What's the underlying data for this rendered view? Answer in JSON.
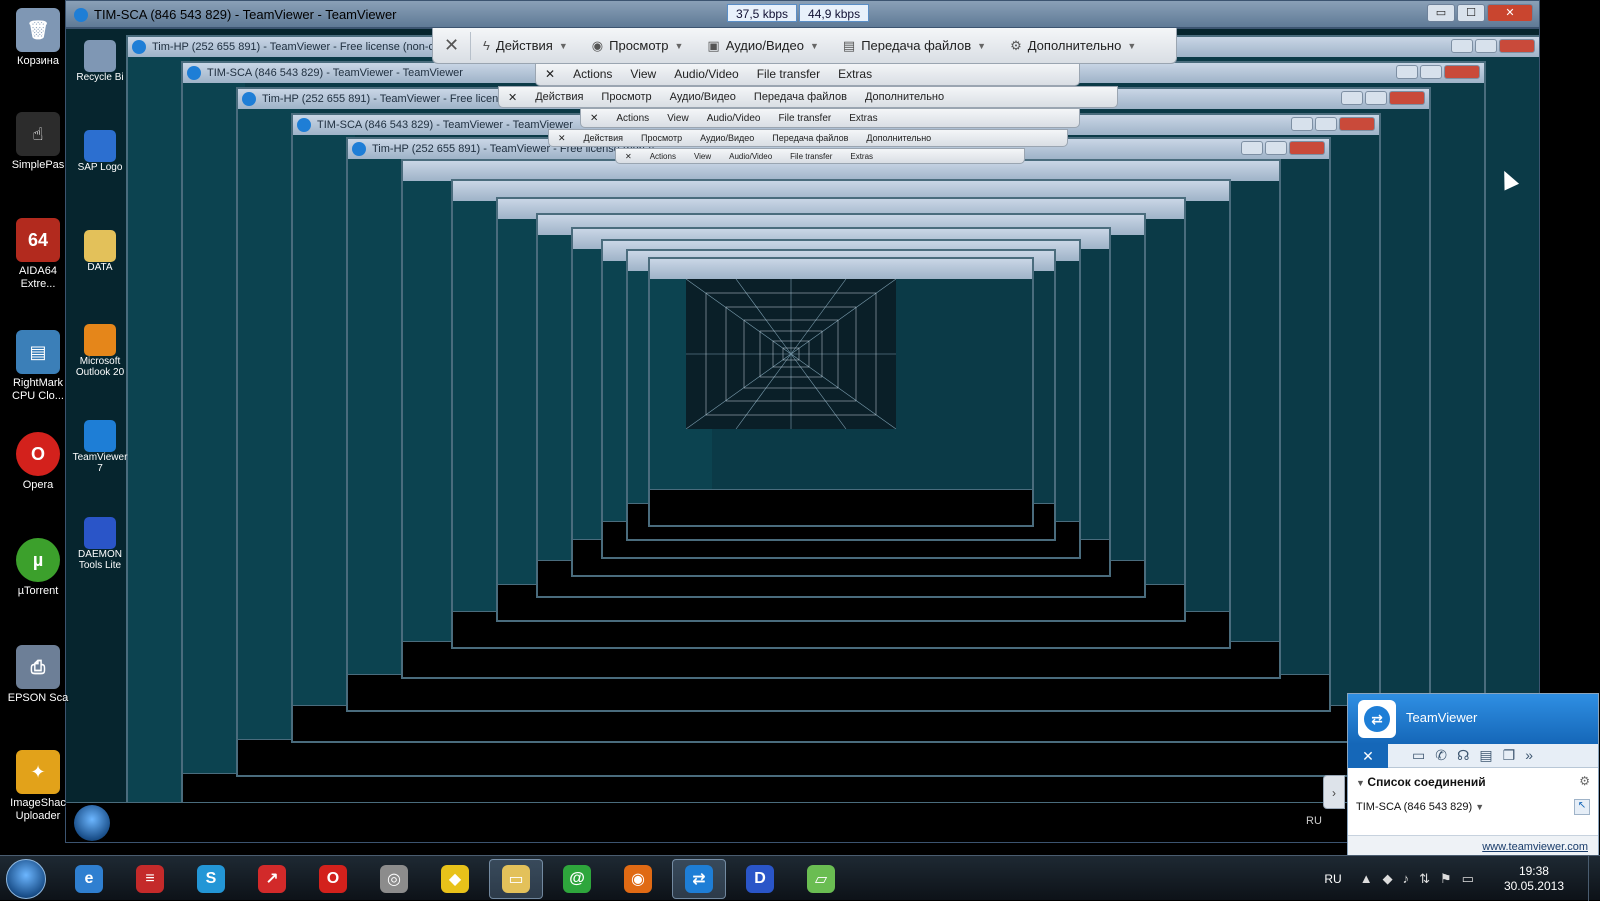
{
  "window": {
    "title": "TIM-SCA (846 543 829) - TeamViewer - TeamViewer",
    "caption_minimize": "▭",
    "caption_maximize": "☐",
    "caption_close": "✕"
  },
  "speed_indicator": {
    "upload": "37,5 kbps",
    "download": "44,9 kbps"
  },
  "remote_toolbar": {
    "close_symbol": "✕",
    "items": [
      {
        "label": "Действия",
        "icon": "lightning-icon"
      },
      {
        "label": "Просмотр",
        "icon": "eye-icon"
      },
      {
        "label": "Аудио/Видео",
        "icon": "video-icon"
      },
      {
        "label": "Передача файлов",
        "icon": "file-transfer-icon"
      },
      {
        "label": "Дополнительно",
        "icon": "gear-icon"
      }
    ],
    "ghost_items_en": [
      "Actions",
      "View",
      "Audio/Video",
      "File transfer",
      "Extras"
    ]
  },
  "nested_titles": [
    "Tim-HP (252 655 891) - TeamViewer - Free license (non-c",
    "TIM-SCA (846 543 829) - TeamViewer - TeamViewer",
    "Tim-HP (252 655 891) - TeamViewer - Free license (non-c",
    "TIM-SCA (846 543 829) - TeamViewer - TeamViewer",
    "Tim-HP (252 655 891) - TeamViewer - Free license (non-c"
  ],
  "desktop_icons": [
    {
      "label": "Корзина",
      "icon": "recycle-bin-icon",
      "color": "#7f97b4"
    },
    {
      "label": "SimplePas",
      "icon": "hand-cursor-icon",
      "color": "#2c2c2c"
    },
    {
      "label": "AIDA64 Extre...",
      "icon": "aida64-icon",
      "color": "#b22a1e"
    },
    {
      "label": "RightMark CPU Clo...",
      "icon": "rightmark-icon",
      "color": "#3b7fb8"
    },
    {
      "label": "Opera",
      "icon": "opera-icon",
      "color": "#d3211c"
    },
    {
      "label": "µTorrent",
      "icon": "utorrent-icon",
      "color": "#3ca02c"
    },
    {
      "label": "EPSON Sca",
      "icon": "scanner-icon",
      "color": "#6d7f97"
    },
    {
      "label": "ImageShac Uploader",
      "icon": "frog-icon",
      "color": "#e2a21a"
    }
  ],
  "nested_desktop_icons": [
    "Recycle Bi",
    "SAP Logo",
    "DATA",
    "Microsoft Outlook 20",
    "TeamViewer 7",
    "DAEMON Tools Lite"
  ],
  "taskbar": {
    "apps": [
      {
        "name": "ie",
        "icon": "internet-explorer-icon",
        "glyph": "e",
        "color": "#2f7fd0"
      },
      {
        "name": "books",
        "icon": "books-icon",
        "glyph": "≡",
        "color": "#c42a2a"
      },
      {
        "name": "skype",
        "icon": "skype-icon",
        "glyph": "S",
        "color": "#2396d6"
      },
      {
        "name": "pdf",
        "icon": "pdf-icon",
        "glyph": "↗",
        "color": "#d22a2a"
      },
      {
        "name": "opera",
        "icon": "opera-icon",
        "glyph": "O",
        "color": "#d3211c"
      },
      {
        "name": "clock",
        "icon": "stamp-icon",
        "glyph": "◎",
        "color": "#8c8c8c"
      },
      {
        "name": "batman",
        "icon": "batman-icon",
        "glyph": "◆",
        "color": "#e8c21a"
      },
      {
        "name": "explorer",
        "icon": "folder-icon",
        "glyph": "▭",
        "color": "#e3c15a"
      },
      {
        "name": "mail",
        "icon": "at-mail-icon",
        "glyph": "@",
        "color": "#2ea63c"
      },
      {
        "name": "firefox",
        "icon": "firefox-icon",
        "glyph": "◉",
        "color": "#e06a14"
      },
      {
        "name": "teamviewer",
        "icon": "teamviewer-icon",
        "glyph": "⇄",
        "color": "#1e7ed6"
      },
      {
        "name": "daemon",
        "icon": "daemon-tools-icon",
        "glyph": "D",
        "color": "#2a55c8"
      },
      {
        "name": "notes",
        "icon": "notepad-icon",
        "glyph": "▱",
        "color": "#6abd52"
      }
    ],
    "lang": "RU",
    "time": "19:38",
    "date": "30.05.2013"
  },
  "tv_panel": {
    "brand": "TeamViewer",
    "section_title": "Список соединений",
    "connection": "TIM-SCA (846 543 829)",
    "footer_link": "www.teamviewer.com",
    "handle_symbol": "›"
  },
  "colors": {
    "remote_bg": "#0b3a47",
    "tv_blue": "#1e7ed6",
    "title_bar": "#9fb3c8"
  }
}
